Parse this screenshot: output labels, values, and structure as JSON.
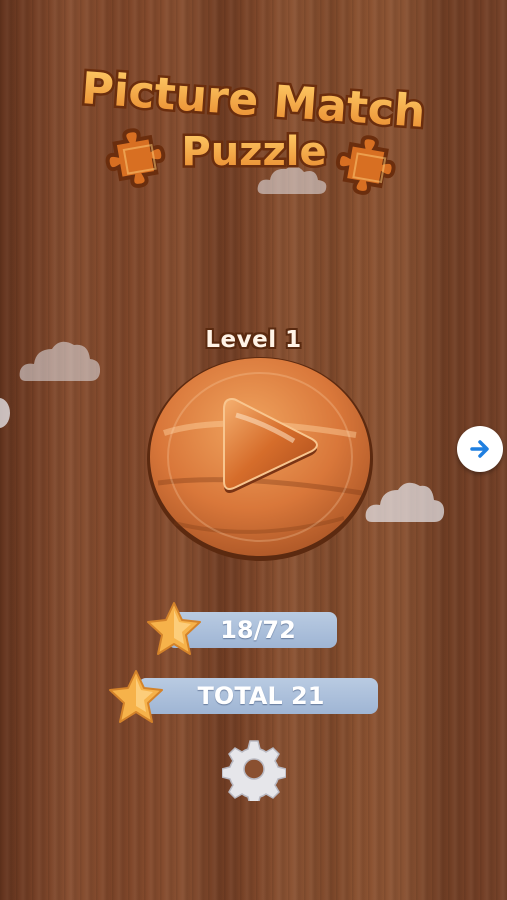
{
  "title": {
    "line1": "Picture Match",
    "line2": "Puzzle"
  },
  "level": {
    "label": "Level 1"
  },
  "stats": {
    "progress": "18/72",
    "total": "TOTAL 21"
  },
  "icons": {
    "play": "play-icon",
    "next": "arrow-right-icon",
    "settings": "gear-icon",
    "star": "star-icon",
    "puzzle": "puzzle-piece-icon"
  },
  "colors": {
    "wood": "#7b4428",
    "title_fill": "#f2a341",
    "title_outline": "#6b2e0e",
    "bar": "#aec2de",
    "star": "#f6b24a",
    "next_arrow": "#1f7fe0"
  }
}
